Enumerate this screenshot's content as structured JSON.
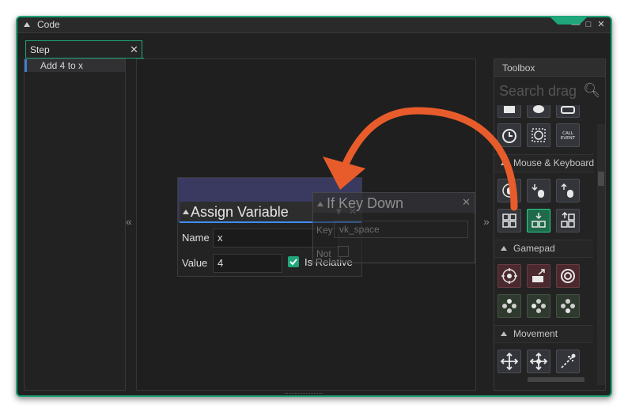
{
  "window": {
    "title": "Code",
    "controls": [
      "—",
      "□",
      "✕"
    ],
    "accent": "#1fa67a"
  },
  "tab": {
    "label": "Step",
    "close": "✕"
  },
  "events": [
    {
      "label": "Add 4 to x"
    }
  ],
  "workspace": {
    "collapse_left": "«",
    "collapse_right": "»"
  },
  "toolbox": {
    "title": "Toolbox",
    "search_placeholder": "Search drag",
    "sections": [
      {
        "label": "Mouse & Keyboard"
      },
      {
        "label": "Gamepad"
      },
      {
        "label": "Movement"
      }
    ],
    "call_event_label": "CALL EVENT"
  },
  "assign_variable": {
    "title": "Assign Variable",
    "name_label": "Name",
    "name_value": "x",
    "value_label": "Value",
    "value_value": "4",
    "relative_label": "Is Relative",
    "relative_checked": true,
    "close": "✕",
    "dropdown": "▾"
  },
  "if_key_down": {
    "title": "If Key Down",
    "key_label": "Key",
    "key_value": "vk_space",
    "not_label": "Not",
    "close": "✕"
  },
  "annotation_arrow_color": "#e85c2b"
}
